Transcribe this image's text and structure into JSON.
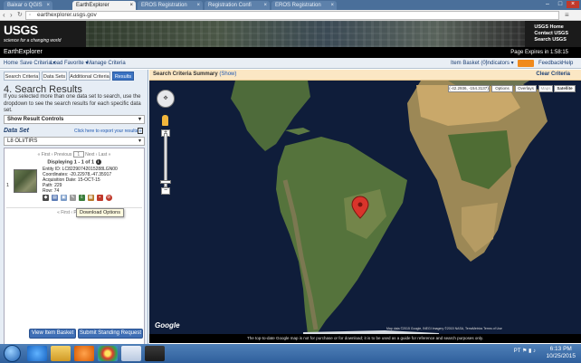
{
  "browser": {
    "tabs": [
      {
        "label": "Baixar o QGIS",
        "active": false
      },
      {
        "label": "EarthExplorer",
        "active": true
      },
      {
        "label": "EROS Registration",
        "active": false
      },
      {
        "label": "Registration Confi",
        "active": false
      },
      {
        "label": "EROS Registration",
        "active": false
      }
    ],
    "url": "earthexplorer.usgs.gov"
  },
  "banner": {
    "logo": "USGS",
    "tagline": "science for a changing world",
    "links": [
      "USGS Home",
      "Contact USGS",
      "Search USGS"
    ]
  },
  "titlebar": {
    "title": "EarthExplorer",
    "session": "Page Expires in 1:58:15"
  },
  "menu": {
    "left": [
      "Home",
      "Save Criteria ▾",
      "Load Favorite ▾",
      "Manage Criteria"
    ],
    "right": [
      "Item Basket (0)",
      "Indicators ▾",
      "Feedback",
      "Help"
    ]
  },
  "left_tabs": [
    "Search Criteria",
    "Data Sets",
    "Additional Criteria",
    "Results"
  ],
  "results": {
    "heading": "4. Search Results",
    "description": "If you selected more than one data set to search, use the dropdown to see the search results for each specific data set.",
    "controls_label": "Show Result Controls",
    "dataset_label": "Data Set",
    "export_link": "Click here to export your results »",
    "dataset_selected": "L8 OLI/TIRS",
    "pager_top": "« First ‹ Previous",
    "pager_top_next": "Next › Last »",
    "page_value": "1",
    "displaying": "Displaying 1 - 1 of 1",
    "row_number": "1",
    "entity": "Entity ID: LC82290742015288LGN00",
    "coordinates": "Coordinates: -20.22978,-47.35917",
    "acq_date": "Acquisition Date: 15-OCT-15",
    "path": "Path: 229",
    "row": "Row: 74",
    "pager_bottom": "« First ‹ Previous",
    "tooltip": "Download Options",
    "view_basket": "View Item Basket »",
    "submit_standing": "Submit Standing Request »"
  },
  "map": {
    "summary_title": "Search Criteria Summary",
    "summary_show": "(Show)",
    "clear": "Clear Criteria",
    "coord_readout": "(-42.2936, -154.3137)",
    "buttons": [
      "Options",
      "Overlays",
      "Maps",
      "Satellite"
    ],
    "google": "Google",
    "copyright": "Map data ©2015 Google, INEGI Imagery ©2015 NASA, TerraMetrics   Terms of Use",
    "disclaimer": "The top-to-date Google map is not for purchase or for download; it is to be used as a guide for reference and search purposes only."
  },
  "taskbar": {
    "lang": "PT",
    "time": "6:13 PM",
    "date": "10/25/2015"
  },
  "colors": {
    "results_tab": "#3b73c2",
    "ocean": "#0f1d3a",
    "marker": "#d9342b"
  }
}
